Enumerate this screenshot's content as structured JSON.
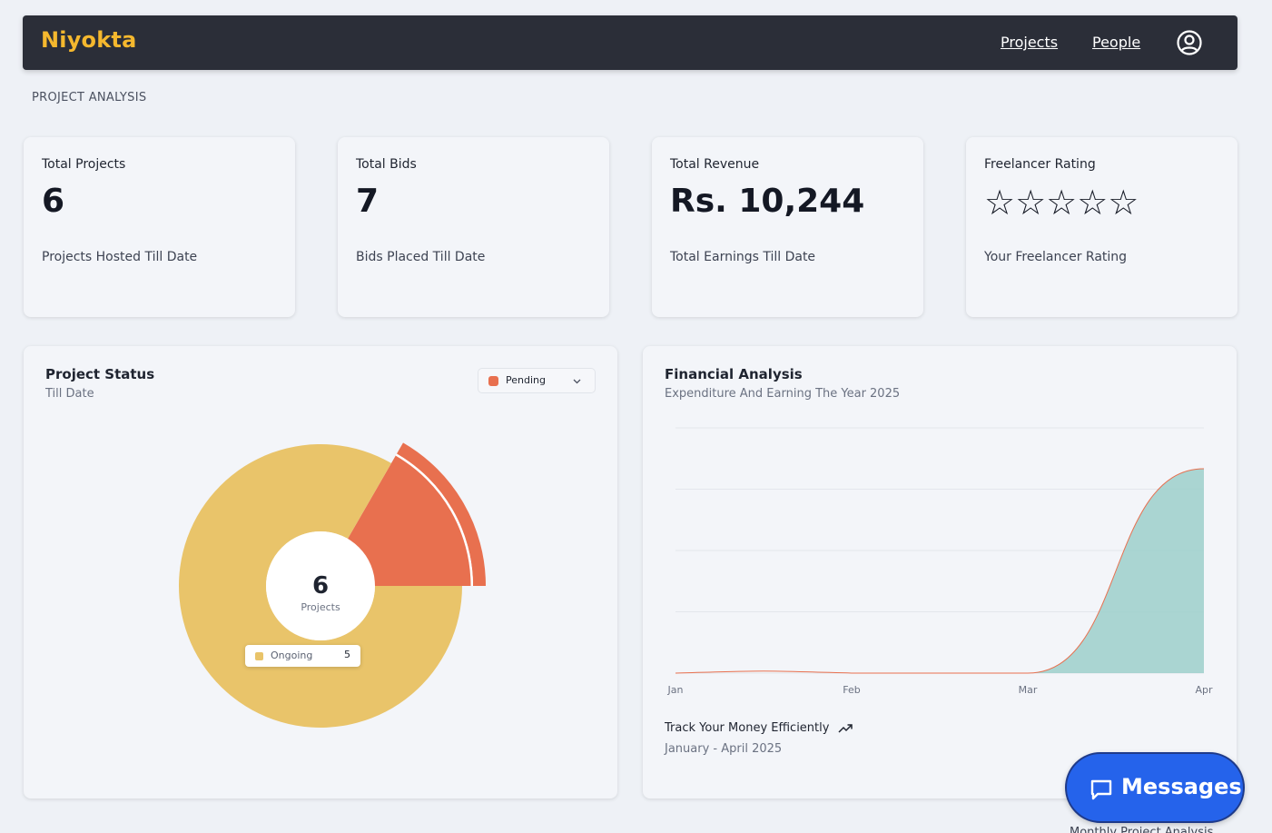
{
  "navbar": {
    "brand": "Niyokta",
    "links": [
      "Projects",
      "People"
    ],
    "profile_icon": "user-circle-icon"
  },
  "section_heading": "PROJECT ANALYSIS",
  "stats": [
    {
      "title": "Total Projects",
      "value": "6",
      "subtitle": "Projects Hosted Till Date"
    },
    {
      "title": "Total Bids",
      "value": "7",
      "subtitle": "Bids Placed Till Date"
    },
    {
      "title": "Total Revenue",
      "value": "Rs. 10,244",
      "subtitle": "Total Earnings Till Date"
    },
    {
      "title": "Freelancer Rating",
      "stars": "☆☆☆☆☆",
      "rating": 0,
      "max_rating": 5,
      "subtitle": "Your Freelancer Rating"
    }
  ],
  "project_status": {
    "title": "Project Status",
    "subtitle": "Till Date",
    "select": {
      "selected": "Pending",
      "color": "#e8704f"
    },
    "center_value": "6",
    "center_label": "Projects",
    "tooltip": {
      "label": "Ongoing",
      "value": "5",
      "color": "#e9c46a"
    }
  },
  "financial": {
    "title": "Financial Analysis",
    "subtitle": "Expenditure And Earning The Year 2025",
    "footer_title": "Track Your Money Efficiently",
    "footer_sub": "January - April 2025"
  },
  "chart_data": [
    {
      "type": "pie",
      "categories": [
        "Ongoing",
        "Pending"
      ],
      "values": [
        5,
        1
      ],
      "colors": [
        "#e9c46a",
        "#e8704f"
      ],
      "active": "Pending",
      "center_text": "6",
      "center_label": "Projects"
    },
    {
      "type": "area",
      "categories": [
        "Jan",
        "Feb",
        "Mar",
        "Apr"
      ],
      "x": [
        "Jan",
        "Feb",
        "Mar",
        "Apr"
      ],
      "series": [
        {
          "values": [
            0,
            0,
            0,
            10244
          ],
          "color": "#e8704f"
        },
        {
          "values": [
            0,
            0,
            0,
            10244
          ],
          "color": "#9ccfcb"
        }
      ],
      "grid": true
    }
  ],
  "messages_button": {
    "label": "Messages",
    "icon": "chat-bubble-icon"
  },
  "peek_text": "Monthly Project Analysis"
}
